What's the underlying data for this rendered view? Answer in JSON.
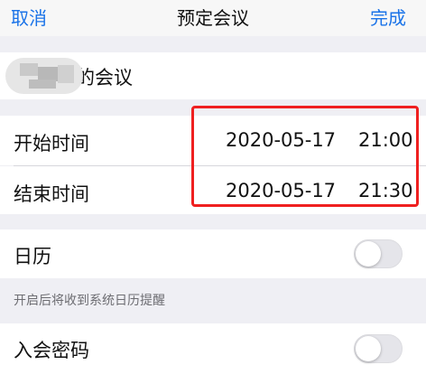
{
  "nav": {
    "cancel": "取消",
    "title": "预定会议",
    "done": "完成"
  },
  "topic": {
    "value_suffix": "的会议"
  },
  "start": {
    "label": "开始时间",
    "date": "2020-05-17",
    "time": "21:00"
  },
  "end": {
    "label": "结束时间",
    "date": "2020-05-17",
    "time": "21:30"
  },
  "calendar": {
    "label": "日历",
    "enabled": false,
    "hint": "开启后将收到系统日历提醒"
  },
  "password": {
    "label": "入会密码",
    "enabled": false
  },
  "colors": {
    "accent": "#1a73e8",
    "highlight": "#ef2020",
    "background": "#efeff4"
  }
}
